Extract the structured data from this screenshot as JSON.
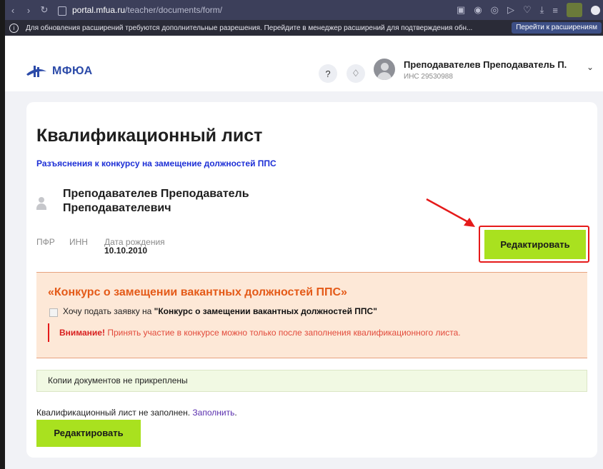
{
  "browser": {
    "url_host": "portal.mfua.ru",
    "url_path": "/teacher/documents/form/",
    "infobar_text": "Для обновления расширений требуются дополнительные разрешения. Перейдите в менеджер расширений для подтверждения обн...",
    "infobar_button": "Перейти к расширениям"
  },
  "header": {
    "logo_text": "МФЮА",
    "user_name": "Преподавателев Преподаватель П.",
    "user_id": "ИНС 29530988"
  },
  "page": {
    "title": "Квалификационный лист",
    "explanation_link": "Разъяснения к конкурсу на замещение должностей ППС",
    "person_name_line1": "Преподавателев Преподаватель",
    "person_name_line2": "Преподавателевич",
    "meta_pfr": "ПФР",
    "meta_inn": "ИНН",
    "meta_birth_label": "Дата рождения",
    "meta_birth_value": "10.10.2010",
    "edit_button": "Редактировать"
  },
  "contest": {
    "title": "«Конкурс о замещении вакантных должностей ППС»",
    "checkbox_prefix": "Хочу подать заявку на ",
    "checkbox_bold": "\"Конкурс о замещении вакантных должностей ППС\"",
    "warning_bold": "Внимание!",
    "warning_text": " Принять участие в конкурсе можно только после заполнения квалификационного листа."
  },
  "documents": {
    "status": "Копии документов не прикреплены"
  },
  "form_status": {
    "text": "Квалификационный лист не заполнен.",
    "link": "Заполнить",
    "period": ".",
    "edit_button": "Редактировать"
  },
  "colors": {
    "accent_green": "#a9e11f",
    "link_blue": "#1d2fd6",
    "contest_orange": "#e45a18",
    "highlight_red": "#e51a1a"
  }
}
